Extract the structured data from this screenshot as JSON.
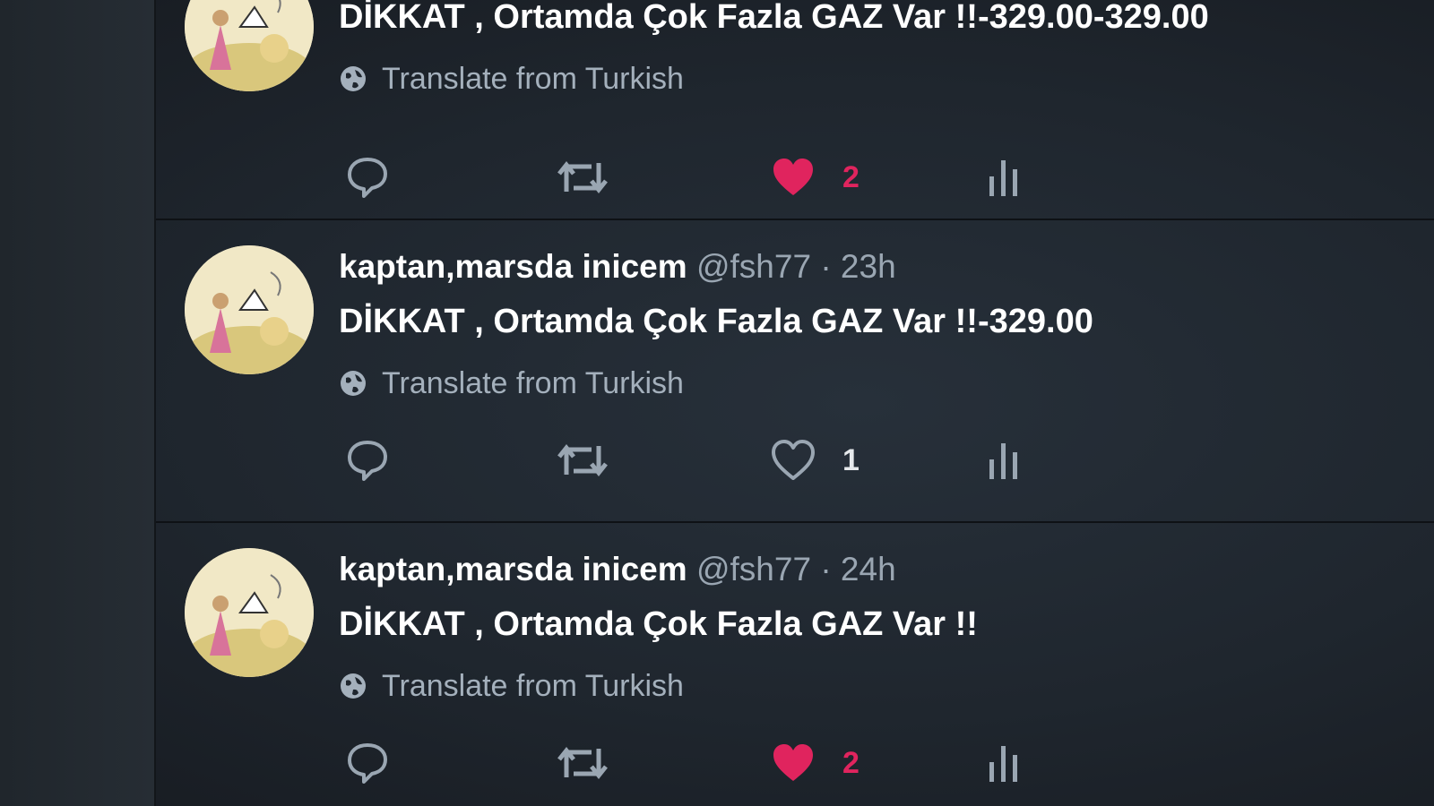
{
  "tweets": [
    {
      "name": "",
      "handle": "",
      "separator": "",
      "time": "",
      "text": "DİKKAT , Ortamda Çok Fazla GAZ Var !!-329.00-329.00",
      "translate_label": "Translate from Turkish",
      "likes": "2",
      "liked": true,
      "icons": [
        "reply-icon",
        "retweet-icon",
        "heart-filled-icon",
        "analytics-icon"
      ]
    },
    {
      "name": "kaptan,marsda inicem",
      "handle": "@fsh77",
      "separator": "·",
      "time": "23h",
      "text": "DİKKAT , Ortamda Çok Fazla GAZ Var !!-329.00",
      "translate_label": "Translate from Turkish",
      "likes": "1",
      "liked": false,
      "icons": [
        "reply-icon",
        "retweet-icon",
        "heart-outline-icon",
        "analytics-icon"
      ]
    },
    {
      "name": "kaptan,marsda inicem",
      "handle": "@fsh77",
      "separator": "·",
      "time": "24h",
      "text": "DİKKAT , Ortamda Çok Fazla GAZ Var !!",
      "translate_label": "Translate from Turkish",
      "likes": "2",
      "liked": true,
      "icons": [
        "reply-icon",
        "retweet-icon",
        "heart-filled-icon",
        "analytics-icon"
      ]
    }
  ],
  "colors": {
    "background": "#1f262e",
    "text_primary": "#ffffff",
    "text_secondary": "#9aa6b2",
    "like_active": "#e0245e",
    "icon": "#9aa6b2"
  }
}
